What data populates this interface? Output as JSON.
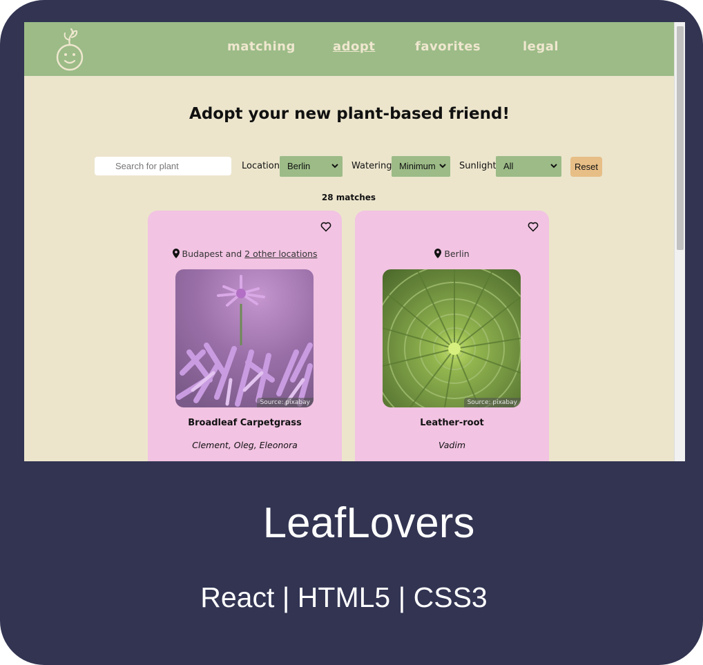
{
  "nav": {
    "logo_icon": "sprout-face-logo-icon",
    "links": [
      {
        "label": "matching",
        "active": false
      },
      {
        "label": "adopt",
        "active": true
      },
      {
        "label": "favorites",
        "active": false
      },
      {
        "label": "legal",
        "active": false
      }
    ]
  },
  "page": {
    "title": "Adopt your new plant-based friend!"
  },
  "filters": {
    "search_placeholder": "Search for plant",
    "location_label": "Location:",
    "location_value": "Berlin",
    "watering_label": "Watering:",
    "watering_value": "Minimum",
    "sunlight_label": "Sunlight:",
    "sunlight_value": "All",
    "reset_label": "Reset"
  },
  "results": {
    "count_text": "28 matches"
  },
  "cards": [
    {
      "location_main": "Budapest and ",
      "location_link": "2 other locations",
      "photo_credit": "Source: pixabay",
      "name": "Broadleaf Carpetgrass",
      "owners": "Clement, Oleg, Eleonora"
    },
    {
      "location_main": "Berlin",
      "location_link": "",
      "photo_credit": "Source: pixabay",
      "name": "Leather-root",
      "owners": "Vadim"
    }
  ],
  "project": {
    "title": "LeafLovers",
    "tech": "React | HTML5 | CSS3"
  },
  "colors": {
    "frame_bg": "#323452",
    "nav_bg": "#9cbb87",
    "page_bg": "#ece5cc",
    "card_bg": "#f2c3e2",
    "reset_bg": "#e7be86"
  }
}
